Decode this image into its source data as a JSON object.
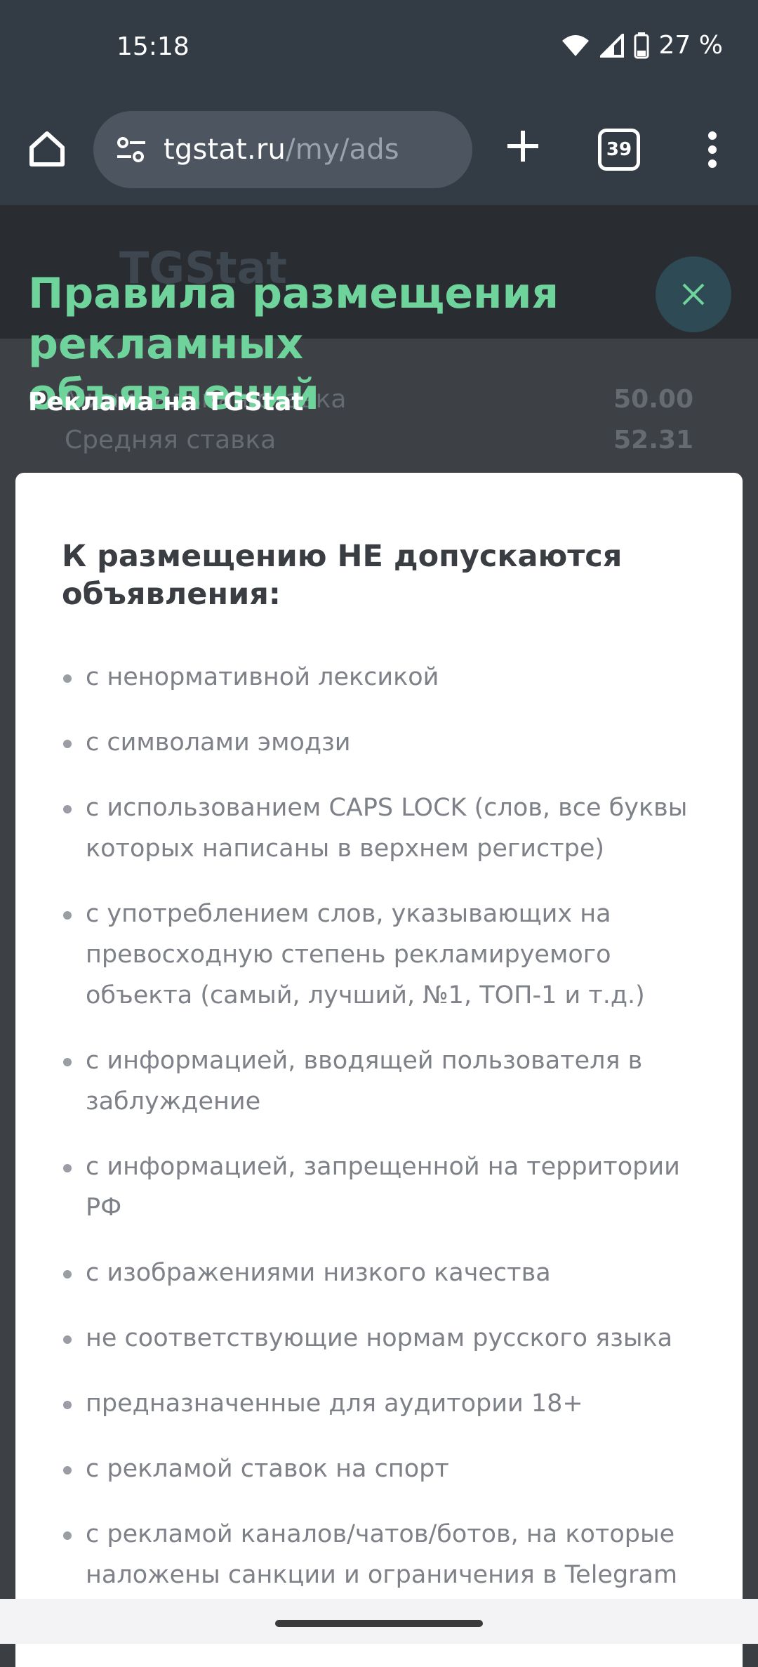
{
  "status_bar": {
    "time": "15:18",
    "battery": "27 %"
  },
  "browser": {
    "url_host": "tgstat.ru",
    "url_path": "/my/ads",
    "tab_count": "39"
  },
  "background": {
    "logo_text": "TGStat",
    "rows": [
      {
        "label": "Минимальная ставка",
        "value": "50.00"
      },
      {
        "label": "Средняя ставка",
        "value": "52.31"
      }
    ]
  },
  "modal": {
    "title": "Правила размещения рекламных объявлений",
    "subtitle": "Реклама на TGStat",
    "heading": "К размещению НЕ допускаются объявления:",
    "rules": [
      "с ненормативной лексикой",
      "с символами эмодзи",
      "с использованием CAPS LOCK (слов, все буквы которых написаны в верхнем регистре)",
      "с употреблением слов, указывающих на превосходную степень рекламируемого объекта (самый, лучший, №1, ТОП-1 и т.д.)",
      "с информацией, вводящей пользователя в заблуждение",
      "с информацией, запрещенной на территории РФ",
      "с изображениями низкого качества",
      "не соответствующие нормам русского языка",
      "предназначенные для аудитории 18+",
      "с рекламой ставок на спорт",
      "с рекламой каналов/чатов/ботов, на которые наложены санкции и ограничения в Telegram"
    ]
  },
  "colors": {
    "accent": "#6fd39c",
    "chrome": "#333b45",
    "card": "#ffffff"
  }
}
